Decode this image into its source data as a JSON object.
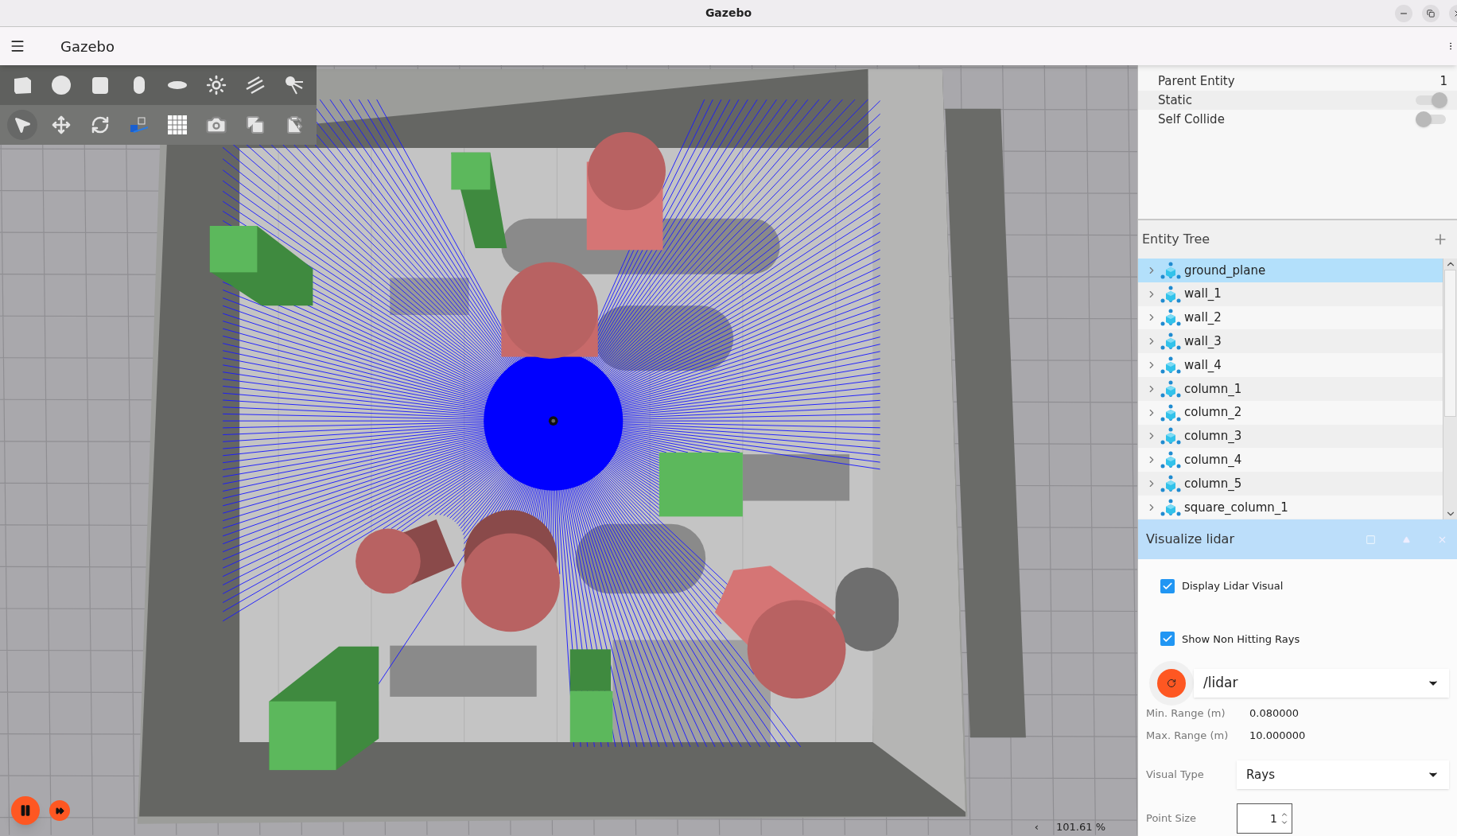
{
  "window": {
    "title": "Gazebo"
  },
  "app_bar": {
    "title": "Gazebo"
  },
  "shape_tools": [
    {
      "kind": "box"
    },
    {
      "kind": "sphere"
    },
    {
      "kind": "cylinder"
    },
    {
      "kind": "capsule"
    },
    {
      "kind": "ellipsoid"
    },
    {
      "kind": "point_light"
    },
    {
      "kind": "directional_light"
    },
    {
      "kind": "spot_light"
    }
  ],
  "transform_tools": [
    {
      "kind": "select",
      "selected": true
    },
    {
      "kind": "translate",
      "selected": false
    },
    {
      "kind": "rotate",
      "selected": false
    },
    {
      "kind": "snap",
      "selected": false
    },
    {
      "kind": "grid",
      "selected": false
    },
    {
      "kind": "screenshot",
      "selected": false
    },
    {
      "kind": "copy",
      "selected": false
    },
    {
      "kind": "paste",
      "selected": false
    }
  ],
  "playback": {
    "running": true
  },
  "viewport": {
    "collapse_glyph": "‹",
    "zoom_text": "101.61 %"
  },
  "component_inspector": {
    "rows": [
      {
        "kind": "value",
        "label": "Parent Entity",
        "value": "1"
      },
      {
        "kind": "toggle",
        "label": "Static",
        "on": true
      },
      {
        "kind": "toggle",
        "label": "Self Collide",
        "on": false
      }
    ]
  },
  "entity_tree": {
    "title": "Entity Tree",
    "items": [
      {
        "name": "ground_plane",
        "selected": true
      },
      {
        "name": "wall_1",
        "selected": false
      },
      {
        "name": "wall_2",
        "selected": false
      },
      {
        "name": "wall_3",
        "selected": false
      },
      {
        "name": "wall_4",
        "selected": false
      },
      {
        "name": "column_1",
        "selected": false
      },
      {
        "name": "column_2",
        "selected": false
      },
      {
        "name": "column_3",
        "selected": false
      },
      {
        "name": "column_4",
        "selected": false
      },
      {
        "name": "column_5",
        "selected": false
      },
      {
        "name": "square_column_1",
        "selected": false
      }
    ]
  },
  "lidar_panel": {
    "title": "Visualize lidar",
    "options": [
      {
        "label": "Display Lidar Visual",
        "checked": true
      },
      {
        "label": "Show Non Hitting Rays",
        "checked": true
      }
    ],
    "topic": "/lidar",
    "ranges": [
      {
        "label": "Min. Range (m)",
        "value": "0.080000"
      },
      {
        "label": "Max. Range (m)",
        "value": "10.000000"
      }
    ],
    "visual_type": {
      "label": "Visual Type",
      "value": "Rays"
    },
    "point_size": {
      "label": "Point Size",
      "value": "1"
    }
  }
}
